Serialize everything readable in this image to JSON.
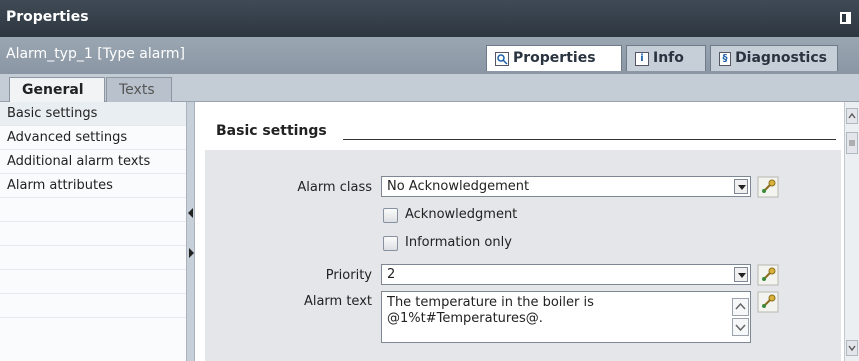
{
  "window": {
    "title": "Properties"
  },
  "object_bar": {
    "name": "Alarm_typ_1 [Type alarm]",
    "tabs": [
      {
        "label": "Properties",
        "icon": "magnifier-icon"
      },
      {
        "label": "Info",
        "icon": "info-icon"
      },
      {
        "label": "Diagnostics",
        "icon": "diagnostics-icon"
      }
    ]
  },
  "subtabs": [
    {
      "label": "General"
    },
    {
      "label": "Texts"
    }
  ],
  "sidebar": {
    "items": [
      {
        "label": "Basic settings"
      },
      {
        "label": "Advanced settings"
      },
      {
        "label": "Additional alarm texts"
      },
      {
        "label": "Alarm attributes"
      }
    ]
  },
  "form": {
    "section_title": "Basic settings",
    "alarm_class": {
      "label": "Alarm class",
      "value": "No Acknowledgement"
    },
    "acknowledgment": {
      "label": "Acknowledgment",
      "checked": false
    },
    "information_only": {
      "label": "Information only",
      "checked": false
    },
    "priority": {
      "label": "Priority",
      "value": "2"
    },
    "alarm_text": {
      "label": "Alarm text",
      "line1": "The temperature in the boiler is",
      "line2": "@1%t#Temperatures@."
    }
  },
  "colors": {
    "titlebar": "#2e3740",
    "object_bar": "#8a96a3",
    "panel": "#e4e6e9",
    "accent_icon": "#c8a23a"
  }
}
